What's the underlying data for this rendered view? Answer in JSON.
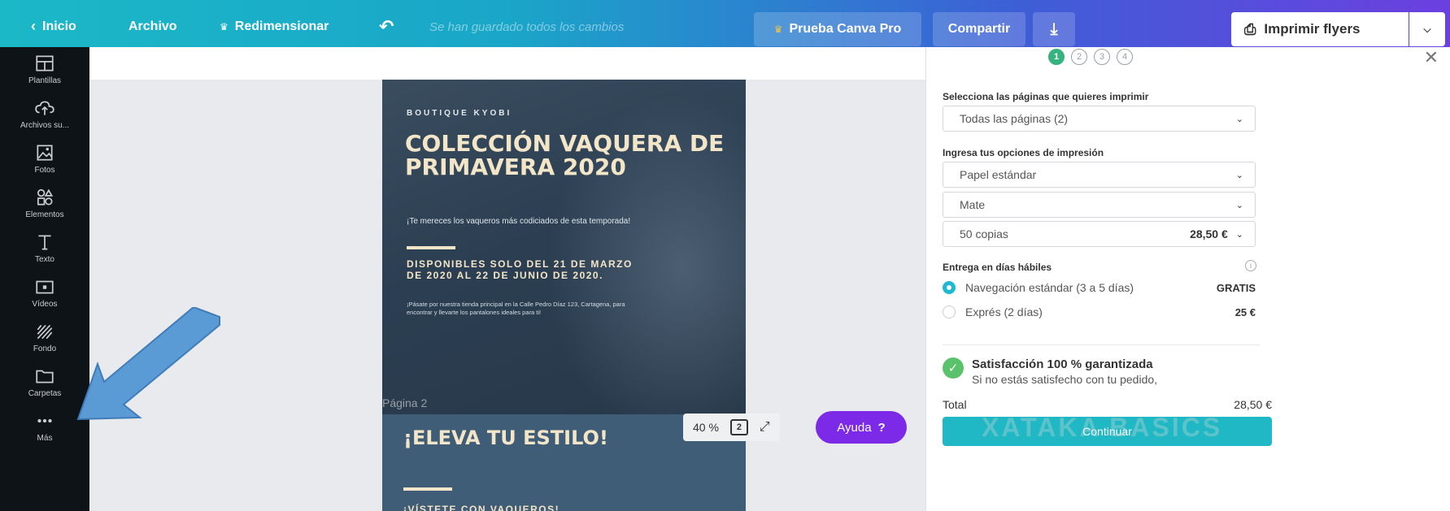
{
  "topbar": {
    "home": "Inicio",
    "file": "Archivo",
    "resize": "Redimensionar",
    "saved": "Se han guardado todos los cambios",
    "pro": "Prueba Canva Pro",
    "share": "Compartir",
    "print": "Imprimir flyers"
  },
  "sidebar": {
    "items": [
      {
        "label": "Plantillas",
        "icon": "templates-icon"
      },
      {
        "label": "Archivos su...",
        "icon": "upload-cloud-icon"
      },
      {
        "label": "Fotos",
        "icon": "photos-icon"
      },
      {
        "label": "Elementos",
        "icon": "elements-icon"
      },
      {
        "label": "Texto",
        "icon": "text-icon"
      },
      {
        "label": "Vídeos",
        "icon": "video-icon"
      },
      {
        "label": "Fondo",
        "icon": "background-icon"
      },
      {
        "label": "Carpetas",
        "icon": "folder-icon"
      },
      {
        "label": "Más",
        "icon": "more-icon"
      }
    ]
  },
  "flyer1": {
    "brand": "BOUTIQUE KYOBI",
    "title": "COLECCIÓN VAQUERA DE PRIMAVERA 2020",
    "subtitle": "¡Te mereces los vaqueros más codiciados de esta temporada!",
    "dates": "DISPONIBLES SOLO DEL 21 DE MARZO DE 2020 AL 22 DE JUNIO DE 2020.",
    "body": "¡Pásate por nuestra tienda principal en la Calle Pedro Díaz 123, Cartagena, para encontrar y llevarte los pantalones ideales para ti!"
  },
  "flyer2": {
    "page_label": "Página 2",
    "title": "¡ELEVA TU ESTILO!",
    "more": "¡VÍSTETE CON VAQUEROS!"
  },
  "canvas": {
    "zoom": "40 %",
    "page_count": "2",
    "help": "Ayuda"
  },
  "panel": {
    "steps": [
      "1",
      "2",
      "3",
      "4"
    ],
    "pages_label": "Selecciona las páginas que quieres imprimir",
    "pages_value": "Todas las páginas (2)",
    "options_label": "Ingresa tus opciones de impresión",
    "paper": "Papel estándar",
    "finish": "Mate",
    "copies": "50 copias",
    "copies_price": "28,50 €",
    "delivery_label": "Entrega en días hábiles",
    "standard": "Navegación estándar (3 a 5 días)",
    "standard_price": "GRATIS",
    "express": "Exprés (2 días)",
    "express_price": "25 €",
    "guarantee_title": "Satisfacción 100 % garantizada",
    "guarantee_text": "Si no estás satisfecho con tu pedido,",
    "total_label": "Total",
    "total_value": "28,50 €",
    "continue": "Continuar"
  },
  "watermark": "XATAKA BASICS",
  "colors": {
    "canva_purple": "#7d2ae8",
    "continue_teal": "#1fb8c4",
    "arrow_blue": "#5b9bd5"
  }
}
